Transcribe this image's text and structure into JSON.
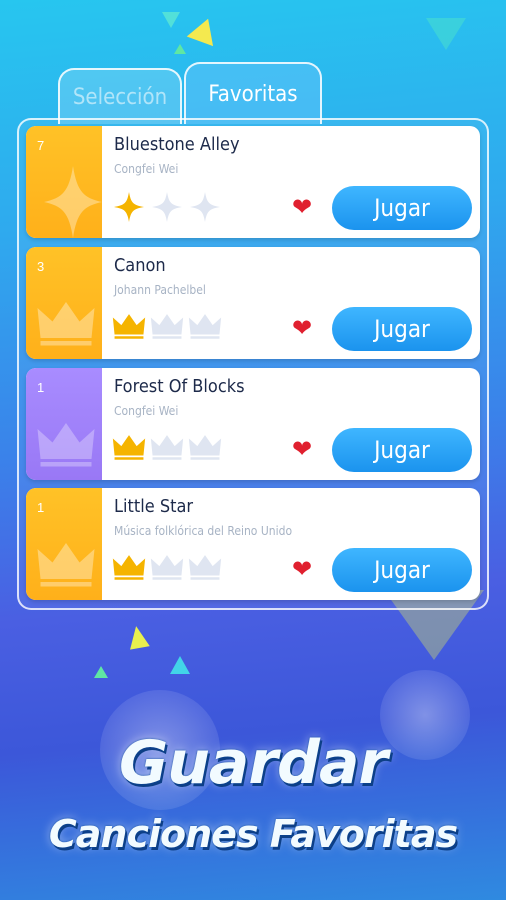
{
  "tabs": [
    {
      "label": "Selección",
      "active": false
    },
    {
      "label": "Favoritas",
      "active": true
    }
  ],
  "songs": [
    {
      "rank": "7",
      "title": "Bluestone Alley",
      "artist": "Congfei Wei",
      "rating_icon": "star",
      "rating": 1,
      "rating_max": 3,
      "favorite": true,
      "side_color": "#ffb81f",
      "play_label": "Jugar"
    },
    {
      "rank": "3",
      "title": "Canon",
      "artist": "Johann Pachelbel",
      "rating_icon": "crown",
      "rating": 1,
      "rating_max": 3,
      "favorite": true,
      "side_color": "#ffb81f",
      "play_label": "Jugar"
    },
    {
      "rank": "1",
      "title": "Forest Of Blocks",
      "artist": "Congfei Wei",
      "rating_icon": "crown",
      "rating": 1,
      "rating_max": 3,
      "favorite": true,
      "side_color": "#9d7ef7",
      "play_label": "Jugar"
    },
    {
      "rank": "1",
      "title": "Little Star",
      "artist": "Música folklórica del Reino Unido",
      "rating_icon": "crown",
      "rating": 1,
      "rating_max": 3,
      "favorite": true,
      "side_color": "#ffb81f",
      "play_label": "Jugar"
    }
  ],
  "promo": {
    "headline": "Guardar",
    "subheadline": "Canciones Favoritas"
  },
  "colors": {
    "accent_blue": "#1b93ee",
    "heart_red": "#e0202f",
    "gold": "#f5b400",
    "inactive_icon": "#dfe5f1"
  }
}
